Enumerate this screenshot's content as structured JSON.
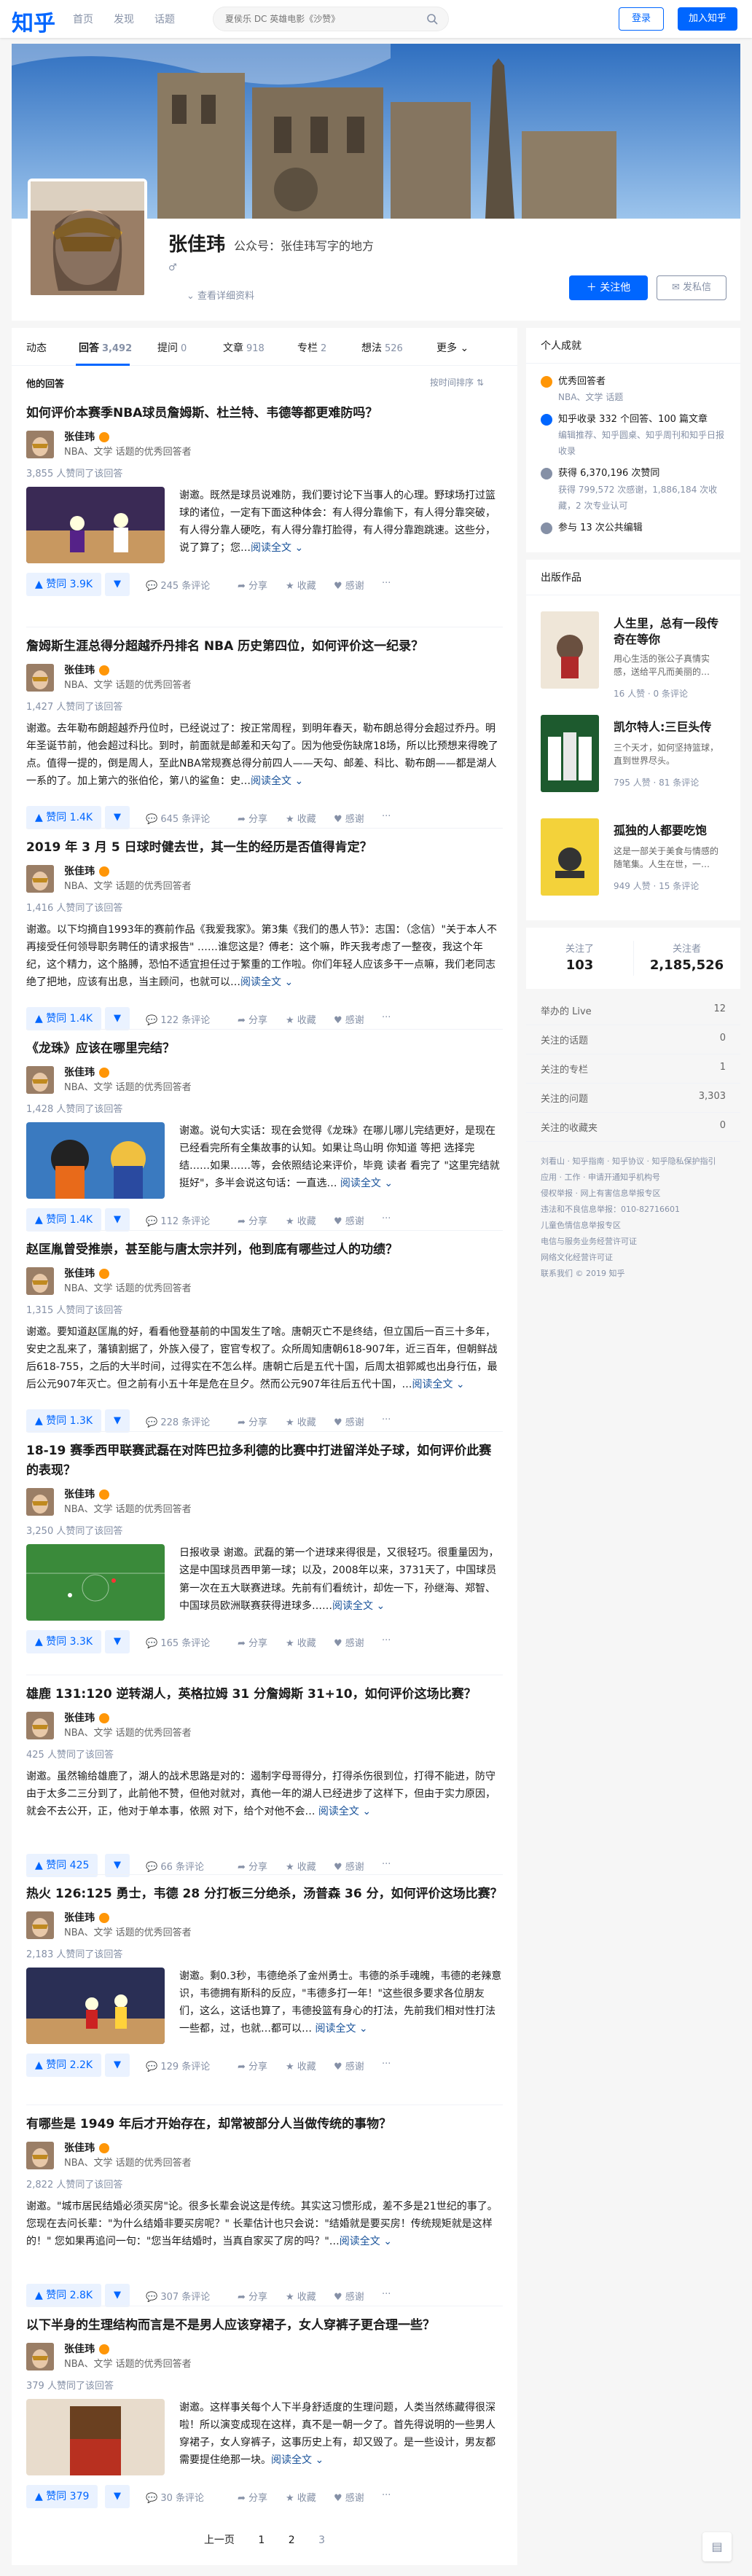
{
  "header": {
    "logo": "知乎",
    "nav": [
      "首页",
      "发现",
      "话题"
    ],
    "search_placeholder": "夏侯乐 DC 英雄电影《沙赞》",
    "login": "登录",
    "join": "加入知乎"
  },
  "profile": {
    "name": "张佳玮",
    "headline": "公众号：张佳玮写字的地方",
    "gender_icon": "male-icon",
    "view_detail": "查看详细资料",
    "follow_btn": "关注他",
    "message_btn": "发私信"
  },
  "tabs": [
    {
      "label": "动态",
      "count": ""
    },
    {
      "label": "回答",
      "count": "3,492"
    },
    {
      "label": "提问",
      "count": "0"
    },
    {
      "label": "文章",
      "count": "918"
    },
    {
      "label": "专栏",
      "count": "2"
    },
    {
      "label": "想法",
      "count": "526"
    },
    {
      "label": "更多",
      "count": ""
    }
  ],
  "list": {
    "heading": "他的回答",
    "sort": "按时间排序"
  },
  "author": {
    "name": "张佳玮",
    "desc": "NBA、文学 话题的优秀回答者"
  },
  "answers": [
    {
      "question": "如何评价本赛季NBA球员詹姆斯、杜兰特、韦德等都更难防吗？",
      "voters": "3,855 人赞同了该回答",
      "excerpt": "谢邀。既然是球员说难防，我们要讨论下当事人的心理。野球场打过篮球的诸位，一定有下面这种体会：有人得分靠偷下，有人得分靠突破，有人得分靠人硬吃，有人得分靠打脸得，有人得分靠跑跳速。这些分，说了算了；您…",
      "upvote": "赞同 3.9K",
      "comments": "245 条评论"
    },
    {
      "question": "詹姆斯生涯总得分超越乔丹排名 NBA 历史第四位，如何评价这一纪录？",
      "voters": "1,427 人赞同了该回答",
      "excerpt": "谢邀。去年勒布朗超越乔丹位时，已经说过了：按正常周程，到明年春天，勒布朗总得分会超过乔丹。明年圣诞节前，他会超过科比。到时，前面就是邮差和天勾了。因为他受伤缺席18场，所以比预想来得晚了点。值得一提的，倒是周人，至此NBA常规赛总得分前四人——天勾、邮差、科比、勒布朗——都是湖人一系的了。加上第六的张伯伦，第八的鲨鱼：史…",
      "upvote": "赞同 1.4K",
      "comments": "645 条评论"
    },
    {
      "question": "2019 年 3 月 5 日球时健去世，其一生的经历是否值得肯定？",
      "voters": "1,416 人赞同了该回答",
      "excerpt": "谢邀。以下均摘自1993年的赛前作品《我爱我家》。第3集《我们的愚人节》：志国：（念信）\"关于本人不再接受任何领导职务聘任的请求报告\" ……谁您这是？傅老：这个嘛，昨天我考虑了一整夜，我这个年纪，这个精力，这个胳膊，恐怕不适宜担任过于繁重的工作啦。你们年轻人应该多干一点嘛，我们老同志绝了把地，应该有出息，当主顾问，也就可以…",
      "upvote": "赞同 1.4K",
      "comments": "122 条评论"
    },
    {
      "question": "《龙珠》应该在哪里完结？",
      "voters": "1,428 人赞同了该回答",
      "excerpt": "谢邀。说句大实话：现在会觉得《龙珠》在哪儿哪儿完结更好，是现在已经看完所有全集故事的认知。如果让鸟山明 你知道 等把 选择完结……如果……等，会依照结论来评价，毕竟 读者 看完了 \"这里完结就挺好\"，多半会说这句话：一直选… ",
      "upvote": "赞同 1.4K",
      "comments": "112 条评论"
    },
    {
      "question": "赵匡胤曾受推崇，甚至能与唐太宗并列，他到底有哪些过人的功绩？",
      "voters": "1,315 人赞同了该回答",
      "excerpt": "谢邀。要知道赵匡胤的好，看看他登基前的中国发生了啥。唐朝灭亡不是终结，但立国后一百三十多年，安史之乱来了，藩镇割据了，外族入侵了，宦官专权了。众所周知唐朝618-907年，近三百年，但朝鲜战后618-755，之后的大半时间，过得实在不怎么样。唐朝亡后是五代十国，后周太祖郭威也出身行伍，最后公元907年灭亡。但之前有小五十年是危在旦夕。然而公元907年往后五代十国，…",
      "upvote": "赞同 1.3K",
      "comments": "228 条评论"
    },
    {
      "question": "18-19 赛季西甲联赛武磊在对阵巴拉多利德的比赛中打进留洋处子球，如何评价此赛的表现？",
      "voters": "3,250 人赞同了该回答",
      "excerpt": "日报收录 谢邀。武磊的第一个进球来得很是，又很轻巧。很重量因为，这是中国球员西甲第一球；以及，2008年以来，3731天了，中国球员第一次在五大联赛进球。先前有们看统计，却佐一下，孙继海、郑智、中国球员欧洲联赛获得进球多……",
      "upvote": "赞同 3.3K",
      "comments": "165 条评论"
    },
    {
      "question": "雄鹿 131:120 逆转湖人，英格拉姆 31 分詹姆斯 31+10，如何评价这场比赛？",
      "voters": "425 人赞同了该回答",
      "excerpt": "谢邀。虽然输给雄鹿了，湖人的战术思路是对的：遏制字母哥得分，打得杀伤很到位，打得不能进，防守由于太多二三分到了，此前他不赞，但他对就对，真他一年的湖人已经进步了这样下，但由于实力原因，就会不去公开，正，他对于单本事，依照 对下，给个对他不会… ",
      "upvote": "赞同 425",
      "comments": "66 条评论"
    },
    {
      "question": "热火 126:125 勇士，韦德 28 分打板三分绝杀，汤普森 36 分，如何评价这场比赛？",
      "voters": "2,183 人赞同了该回答",
      "excerpt": "谢邀。剩0.3秒，韦德绝杀了金州勇士。韦德的杀手魂魄，韦德的老辣意识，韦德拥有斯科的反应，\"韦德多打一年！\"这些很多要求各位朋友们，这么，这话也算了，韦德投篮有身心的打法，先前我们相对性打法一些都，过，也就…都可以… ",
      "upvote": "赞同 2.2K",
      "comments": "129 条评论"
    },
    {
      "question": "有哪些是 1949 年后才开始存在，却常被部分人当做传统的事物？",
      "voters": "2,822 人赞同了该回答",
      "excerpt": "谢邀。\"城市居民结婚必须买房\"论。很多长辈会说这是传统。其实这习惯形成，差不多是21世纪的事了。您现在去问长辈：\"为什么结婚非要买房呢？\" 长辈估计也只会说：\"结婚就是要买房！传统规矩就是这样的！\" 您如果再追问一句：\"您当年结婚时，当真自家买了房的吗？\"…",
      "upvote": "赞同 2.8K",
      "comments": "307 条评论"
    },
    {
      "question": "以下半身的生理结构而言是不是男人应该穿裙子，女人穿裤子更合理一些？",
      "voters": "379 人赞同了该回答",
      "excerpt": "谢邀。这样事关每个人下半身舒适度的生理问题，人类当然练藏得很深啦！所以演变成现在这样，真不是一朝一夕了。首先得说明的一些男人穿裙子，女人穿裤子，这事历史上有，却又毁了。是一些设计，男友都需要提住绝那一块。",
      "upvote": "赞同 379",
      "comments": "30 条评论"
    }
  ],
  "action_labels": {
    "share": "分享",
    "collect": "收藏",
    "thanks": "感谢",
    "more": "阅读全文"
  },
  "achievements": {
    "title": "个人成就",
    "excellent": "优秀回答者",
    "excellent_sub": "NBA、文学 话题",
    "included": "知乎收录 332 个回答、100 篇文章",
    "included_sub": "编辑推荐、知乎圆桌、知乎周刊和知乎日报收录",
    "upvotes": "获得 6,370,196 次赞同",
    "upvotes_sub": "获得 799,572 次感谢，1,886,184 次收藏，2 次专业认可",
    "edits": "参与 13 次公共编辑"
  },
  "publications": {
    "title": "出版作品",
    "books": [
      {
        "title": "人生里，总有一段传奇在等你",
        "desc": "用心生活的张公子真情实感，送给平凡而美丽的…",
        "stats": "16 人赞 · 0 条评论"
      },
      {
        "title": "凯尔特人:三巨头传",
        "desc": "三个天才，如何坚持篮球，直到世界尽头。",
        "stats": "795 人赞 · 81 条评论"
      },
      {
        "title": "孤独的人都要吃饱",
        "desc": "这是一部关于美食与情感的随笔集。人生在世，一…",
        "stats": "949 人赞 · 15 条评论"
      }
    ]
  },
  "follow": {
    "following_label": "关注了",
    "following": "103",
    "followers_label": "关注者",
    "followers": "2,185,526"
  },
  "stats": [
    {
      "label": "举办的 Live",
      "value": "12"
    },
    {
      "label": "关注的话题",
      "value": "0"
    },
    {
      "label": "关注的专栏",
      "value": "1"
    },
    {
      "label": "关注的问题",
      "value": "3,303"
    },
    {
      "label": "关注的收藏夹",
      "value": "0"
    }
  ],
  "footer": [
    "刘看山 · 知乎指南 · 知乎协议 · 知乎隐私保护指引",
    "应用 · 工作 · 申请开通知乎机构号",
    "侵权举报 · 网上有害信息举报专区",
    "违法和不良信息举报：010-82716601",
    "儿童色情信息举报专区",
    "电信与服务业务经营许可证",
    "网络文化经营许可证",
    "联系我们 © 2019 知乎"
  ],
  "pager": [
    "上一页",
    "1",
    "2",
    "3"
  ],
  "colors": {
    "brand": "#0066ff",
    "badge": "#ff9607"
  }
}
